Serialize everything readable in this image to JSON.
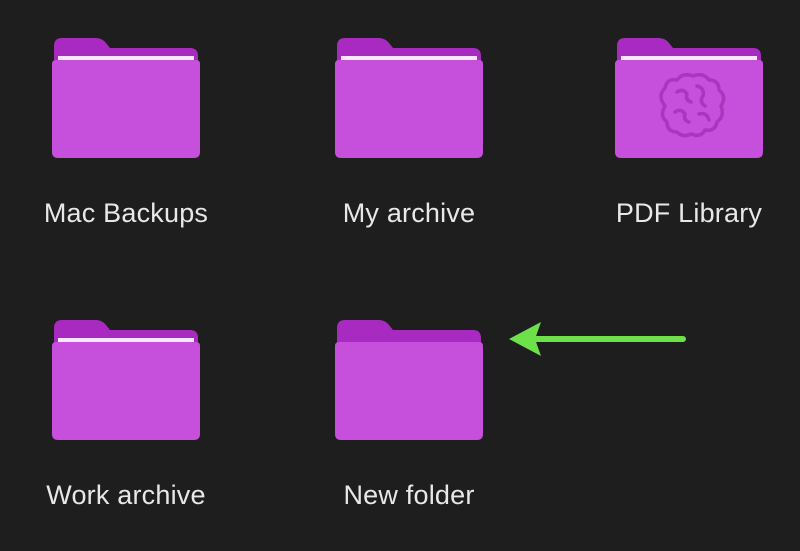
{
  "colors": {
    "background": "#1e1e1e",
    "folder_back": "#a92ac0",
    "folder_front": "#c64fdc",
    "folder_paper": "#f6e8fa",
    "arrow": "#6ee04a"
  },
  "folders": [
    {
      "label": "Mac Backups",
      "icon": "folder-icon"
    },
    {
      "label": "My archive",
      "icon": "folder-icon"
    },
    {
      "label": "PDF Library",
      "icon": "brain-folder-icon"
    },
    {
      "label": "Work archive",
      "icon": "folder-icon"
    },
    {
      "label": "New folder",
      "icon": "folder-icon"
    }
  ],
  "annotation": {
    "icon": "arrow-left-icon"
  }
}
